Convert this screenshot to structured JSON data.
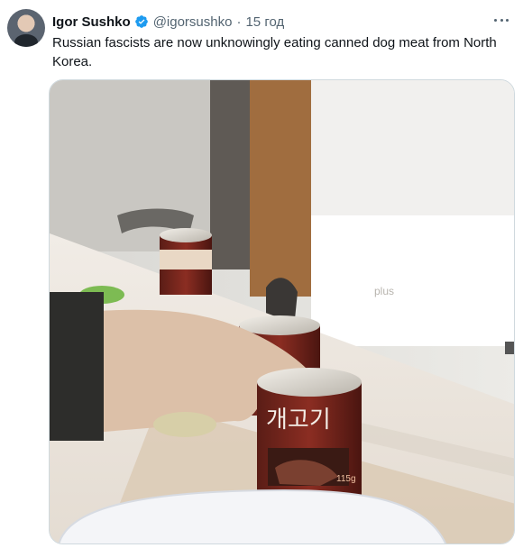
{
  "tweet": {
    "author_name": "Igor Sushko",
    "handle": "@igorsushko",
    "separator": "·",
    "time": "15 год",
    "text": "Russian fascists are now unknowingly eating canned dog meat from North Korea."
  },
  "media": {
    "can_label": "개고기",
    "can_weight": "115g",
    "watermark": "plus"
  },
  "icons": {
    "avatar": "user-avatar",
    "verified": "verified-badge-icon",
    "more": "more-options-icon"
  },
  "colors": {
    "verified_blue": "#1d9bf0",
    "secondary_text": "#536471"
  }
}
